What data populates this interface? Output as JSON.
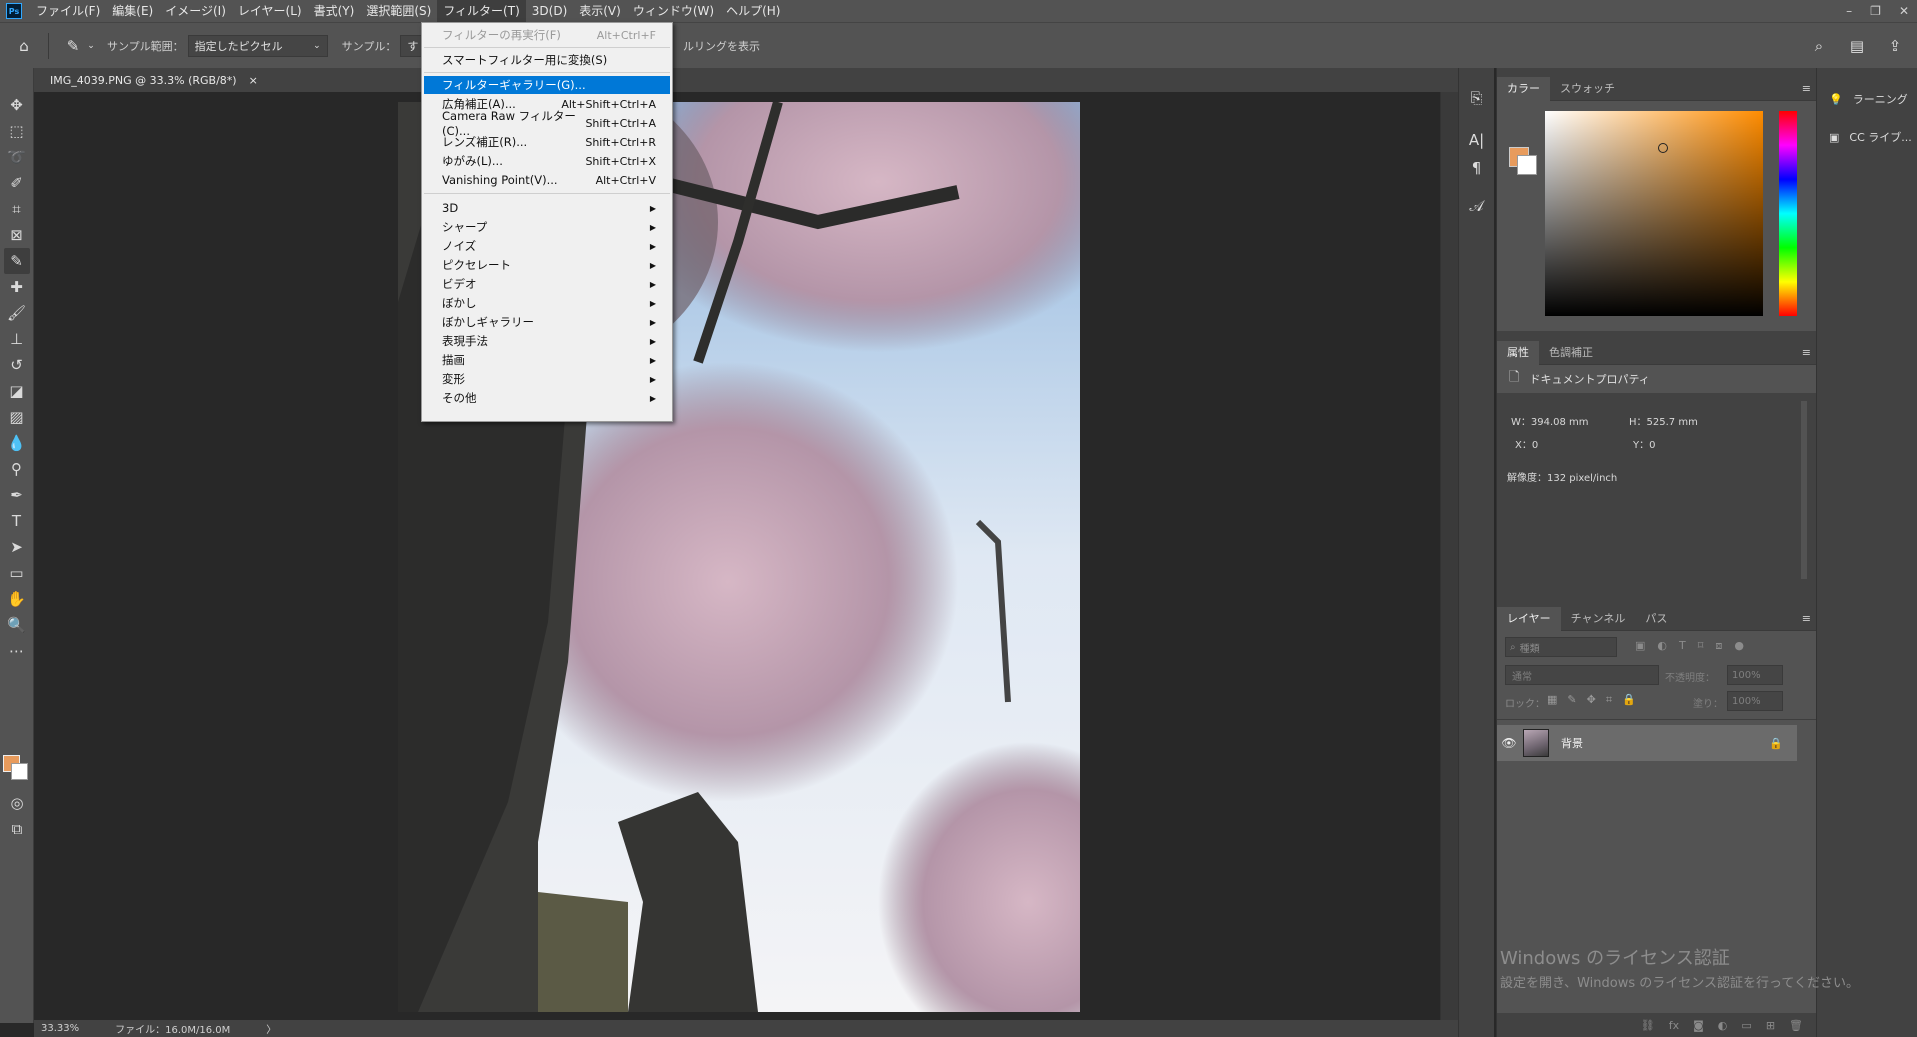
{
  "menubar": {
    "logo": "Ps",
    "items": [
      "ファイル(F)",
      "編集(E)",
      "イメージ(I)",
      "レイヤー(L)",
      "書式(Y)",
      "選択範囲(S)",
      "フィルター(T)",
      "3D(D)",
      "表示(V)",
      "ウィンドウ(W)",
      "ヘルプ(H)"
    ],
    "active_index": 6
  },
  "window_controls": {
    "minimize": "–",
    "restore": "❐",
    "close": "✕"
  },
  "options_bar": {
    "sample_range_label": "サンプル範囲：",
    "sample_range_value": "指定したピクセル",
    "sample_label": "サンプル：",
    "sample_value_partial": "す",
    "ring_label_partial": "ルリングを表示"
  },
  "document": {
    "tab_title": "IMG_4039.PNG @ 33.3% (RGB/8*)",
    "close": "×"
  },
  "status": {
    "zoom": "33.33%",
    "file_info": "ファイル：16.0M/16.0M",
    "arrow": "〉"
  },
  "filter_menu": {
    "items": [
      {
        "label": "フィルターの再実行(F)",
        "shortcut": "Alt+Ctrl+F",
        "disabled": true
      },
      {
        "label": "スマートフィルター用に変換(S)",
        "shortcut": ""
      },
      {
        "label": "フィルターギャラリー(G)...",
        "shortcut": "",
        "highlighted": true
      },
      {
        "label": "広角補正(A)...",
        "shortcut": "Alt+Shift+Ctrl+A"
      },
      {
        "label": "Camera Raw フィルター(C)...",
        "shortcut": "Shift+Ctrl+A"
      },
      {
        "label": "レンズ補正(R)...",
        "shortcut": "Shift+Ctrl+R"
      },
      {
        "label": "ゆがみ(L)...",
        "shortcut": "Shift+Ctrl+X"
      },
      {
        "label": "Vanishing Point(V)...",
        "shortcut": "Alt+Ctrl+V"
      },
      {
        "label": "3D",
        "submenu": true
      },
      {
        "label": "シャープ",
        "submenu": true
      },
      {
        "label": "ノイズ",
        "submenu": true
      },
      {
        "label": "ピクセレート",
        "submenu": true
      },
      {
        "label": "ビデオ",
        "submenu": true
      },
      {
        "label": "ぼかし",
        "submenu": true
      },
      {
        "label": "ぼかしギャラリー",
        "submenu": true
      },
      {
        "label": "表現手法",
        "submenu": true
      },
      {
        "label": "描画",
        "submenu": true
      },
      {
        "label": "変形",
        "submenu": true
      },
      {
        "label": "その他",
        "submenu": true
      }
    ]
  },
  "color_panel": {
    "tabs": [
      "カラー",
      "スウォッチ"
    ],
    "foreground": "#e89b5c",
    "background": "#ffffff"
  },
  "properties_panel": {
    "tabs": [
      "属性",
      "色調補正"
    ],
    "header": "ドキュメントプロパティ",
    "w": "W：394.08 mm",
    "h": "H：525.7 mm",
    "x": "X：0",
    "y": "Y：0",
    "resolution": "解像度：132 pixel/inch"
  },
  "layers_panel": {
    "tabs": [
      "レイヤー",
      "チャンネル",
      "パス"
    ],
    "search_placeholder": "種類",
    "blend_mode": "通常",
    "opacity_label": "不透明度：",
    "opacity_value": "100%",
    "lock_label": "ロック：",
    "fill_label": "塗り：",
    "fill_value": "100%",
    "layers": [
      {
        "name": "背景",
        "visible": true,
        "locked": true
      }
    ]
  },
  "side_mini": {
    "learn": "ラーニング",
    "libraries": "CC ライブ..."
  },
  "watermark": {
    "line1": "Windows のライセンス認証",
    "line2": "設定を開き、Windows のライセンス認証を行ってください。"
  },
  "colors": {
    "ui_dark": "#282828",
    "ui_panel": "#535353",
    "highlight": "#0078d7",
    "accent_fg": "#e89b5c"
  }
}
